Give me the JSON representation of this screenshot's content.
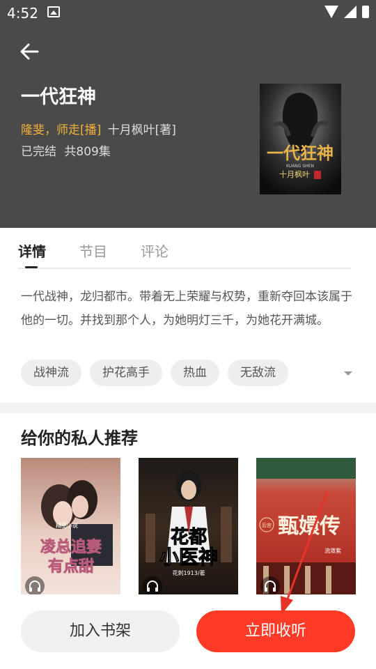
{
  "status_bar": {
    "time": "4:52"
  },
  "book": {
    "title": "一代狂神",
    "narrators": "隆斐，师走[播]",
    "author": "十月枫叶[著]",
    "status": "已完结",
    "episodes": "共809集",
    "cover_title": "一代狂神",
    "cover_subtitle": "KUANG SHEN",
    "cover_author": "十月枫叶"
  },
  "tabs": [
    {
      "label": "详情",
      "active": true
    },
    {
      "label": "节目",
      "active": false
    },
    {
      "label": "评论",
      "active": false
    }
  ],
  "description": "一代战神，龙归都市。带着无上荣耀与权势，重新夺回本该属于他的一切。并找到那个人，为她明灯三千，为她花开满城。",
  "tags": [
    "战神流",
    "护花高手",
    "热血",
    "无敌流"
  ],
  "recommend": {
    "title": "给你的私人推荐",
    "books": [
      {
        "cover_text_1": "凌总追妻",
        "cover_text_2": "有点甜",
        "cover_badge": "精品小说"
      },
      {
        "cover_text_1": "花都",
        "cover_text_2": "小医神",
        "cover_author": "花刺1913/著"
      },
      {
        "cover_text_1": "甄嬛传",
        "cover_badge": "后宫",
        "cover_author": "流潋紫"
      }
    ]
  },
  "actions": {
    "add_shelf": "加入书架",
    "listen_now": "立即收听"
  },
  "colors": {
    "header_bg": "#4a4a4a",
    "narrator": "#f3b13a",
    "primary_button": "#ff3b28",
    "arrow": "#e8332a"
  }
}
